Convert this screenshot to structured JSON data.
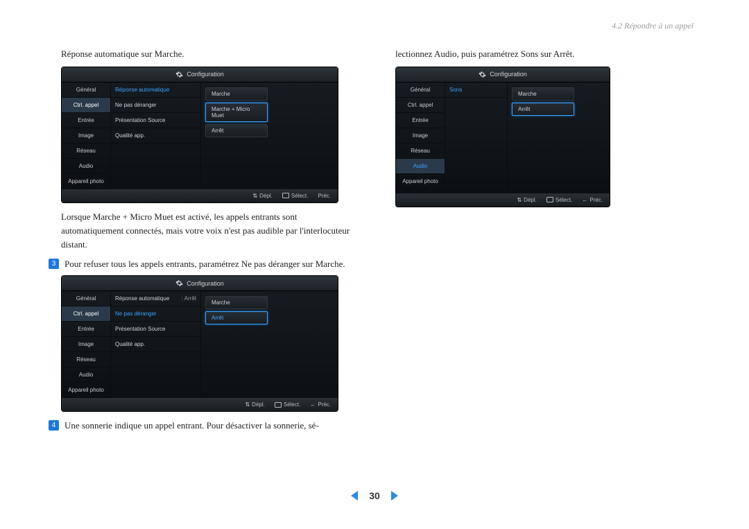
{
  "breadcrumb": "4.2 Répondre à un appel",
  "page_number": "30",
  "left": {
    "caption_top": "Réponse automatique sur Marche.",
    "para1": "Lorsque Marche + Micro Muet est activé, les appels entrants sont automatiquement connectés, mais votre voix n'est pas audible par l'interlocuteur distant.",
    "step3_num": "3",
    "step3_text": "Pour refuser tous les appels entrants, paramétrez Ne pas déranger sur Marche.",
    "step4_num": "4",
    "step4_text": "Une sonnerie indique un appel entrant. Pour désactiver la sonnerie, sé-"
  },
  "right": {
    "caption_top": "lectionnez Audio, puis paramétrez Sons sur Arrêt."
  },
  "configTitle": "Configuration",
  "footer": {
    "depl": "Dépl.",
    "select": "Sélect.",
    "prec": "Préc."
  },
  "sidebar_items": [
    "Général",
    "Ctrl. appel",
    "Entrée",
    "Image",
    "Réseau",
    "Audio",
    "Appareil photo"
  ],
  "panelA": {
    "active_index": 1,
    "settings": [
      {
        "label": "Réponse automatique",
        "selected": true
      },
      {
        "label": "Ne pas déranger"
      },
      {
        "label": "Présentation Source"
      },
      {
        "label": "Qualité app."
      }
    ],
    "options": [
      {
        "label": "Marche",
        "highlight": false
      },
      {
        "label": "Marche + Micro Muet",
        "highlight": true
      },
      {
        "label": "Arrêt",
        "highlight": false
      }
    ]
  },
  "panelB": {
    "active_index": 1,
    "settings": [
      {
        "label": "Réponse automatique",
        "val": ": Arrêt"
      },
      {
        "label": "Ne pas déranger",
        "selected": true
      },
      {
        "label": "Présentation Source"
      },
      {
        "label": "Qualité app."
      }
    ],
    "options": [
      {
        "label": "Marche",
        "highlight": false
      },
      {
        "label": "Arrêt",
        "highlight": true,
        "bluetext": true
      }
    ]
  },
  "panelC": {
    "active_index": 5,
    "settings": [
      {
        "label": "Sons",
        "selected": true
      }
    ],
    "options": [
      {
        "label": "Marche",
        "highlight": false
      },
      {
        "label": "Arrêt",
        "highlight": true
      }
    ]
  }
}
